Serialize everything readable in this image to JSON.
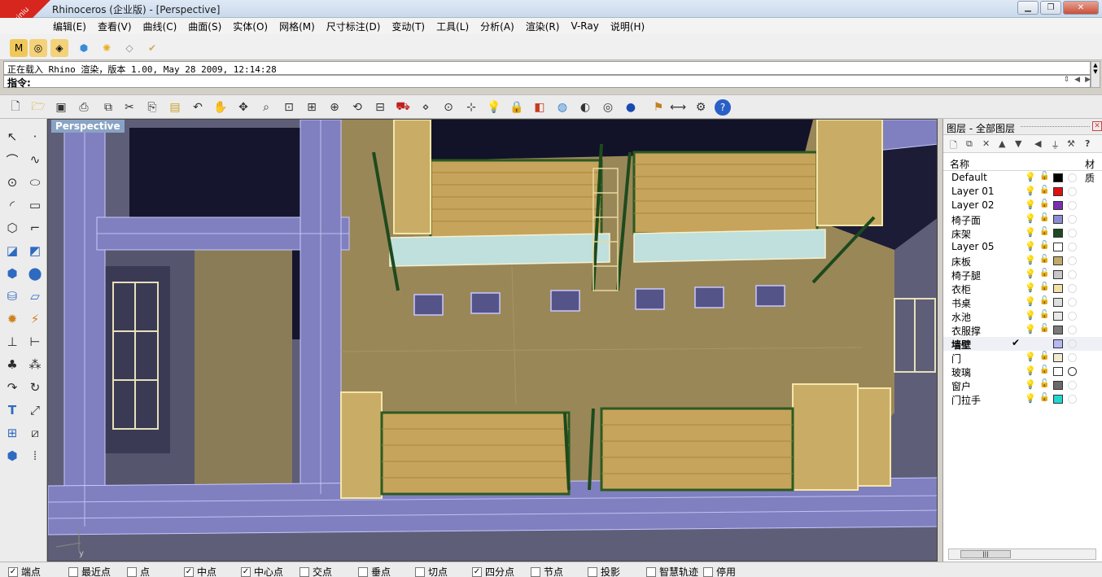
{
  "window": {
    "title": "Rhinoceros (企业版) - [Perspective]",
    "buttons": [
      "minimize",
      "restore",
      "close"
    ]
  },
  "logo": {
    "line1": "xuexiniu",
    "line2": "学犀牛中文网"
  },
  "menu": [
    "编辑(E)",
    "查看(V)",
    "曲线(C)",
    "曲面(S)",
    "实体(O)",
    "网格(M)",
    "尺寸标注(D)",
    "变动(T)",
    "工具(L)",
    "分析(A)",
    "渲染(R)",
    "V-Ray",
    "说明(H)"
  ],
  "command": {
    "history": "正在载入 Rhino 渲染，版本 1.00, May 28 2009, 12:14:28",
    "prompt": "指令:",
    "value": ""
  },
  "viewport": {
    "label": "Perspective",
    "axis_y": "y"
  },
  "layers": {
    "title": "图层 - 全部图层",
    "col_name": "名称",
    "col_material": "材质",
    "rows": [
      {
        "name": "Default",
        "color": "#000000",
        "current": false
      },
      {
        "name": "Layer 01",
        "color": "#e01010",
        "current": false
      },
      {
        "name": "Layer 02",
        "color": "#7a2fb0",
        "current": false
      },
      {
        "name": "椅子面",
        "color": "#8c8cd4",
        "current": false
      },
      {
        "name": "床架",
        "color": "#1f4a1f",
        "current": false
      },
      {
        "name": "Layer 05",
        "color": "#ffffff",
        "current": false
      },
      {
        "name": "床板",
        "color": "#c2aa6a",
        "current": false
      },
      {
        "name": "椅子腿",
        "color": "#c8c8c8",
        "current": false
      },
      {
        "name": "衣柜",
        "color": "#f3e0a8",
        "current": false
      },
      {
        "name": "书桌",
        "color": "#dedede",
        "current": false
      },
      {
        "name": "水池",
        "color": "#e8e8e8",
        "current": false
      },
      {
        "name": "衣服撑",
        "color": "#7a7a7a",
        "current": false
      },
      {
        "name": "墙壁",
        "color": "#b8b8f0",
        "current": true
      },
      {
        "name": "门",
        "color": "#f0ead0",
        "current": false
      },
      {
        "name": "玻璃",
        "color": "#ffffff",
        "current": false
      },
      {
        "name": "窗户",
        "color": "#6a6a6a",
        "current": false
      },
      {
        "name": "门拉手",
        "color": "#20d8d0",
        "current": false
      }
    ]
  },
  "osnap": [
    {
      "label": "端点",
      "checked": true
    },
    {
      "label": "最近点",
      "checked": false
    },
    {
      "label": "点",
      "checked": false
    },
    {
      "label": "中点",
      "checked": true
    },
    {
      "label": "中心点",
      "checked": true
    },
    {
      "label": "交点",
      "checked": false
    },
    {
      "label": "垂点",
      "checked": false
    },
    {
      "label": "切点",
      "checked": false
    },
    {
      "label": "四分点",
      "checked": true
    },
    {
      "label": "节点",
      "checked": false
    },
    {
      "label": "投影",
      "checked": false
    },
    {
      "label": "智慧轨迹",
      "checked": false
    },
    {
      "label": "停用",
      "checked": false
    }
  ]
}
